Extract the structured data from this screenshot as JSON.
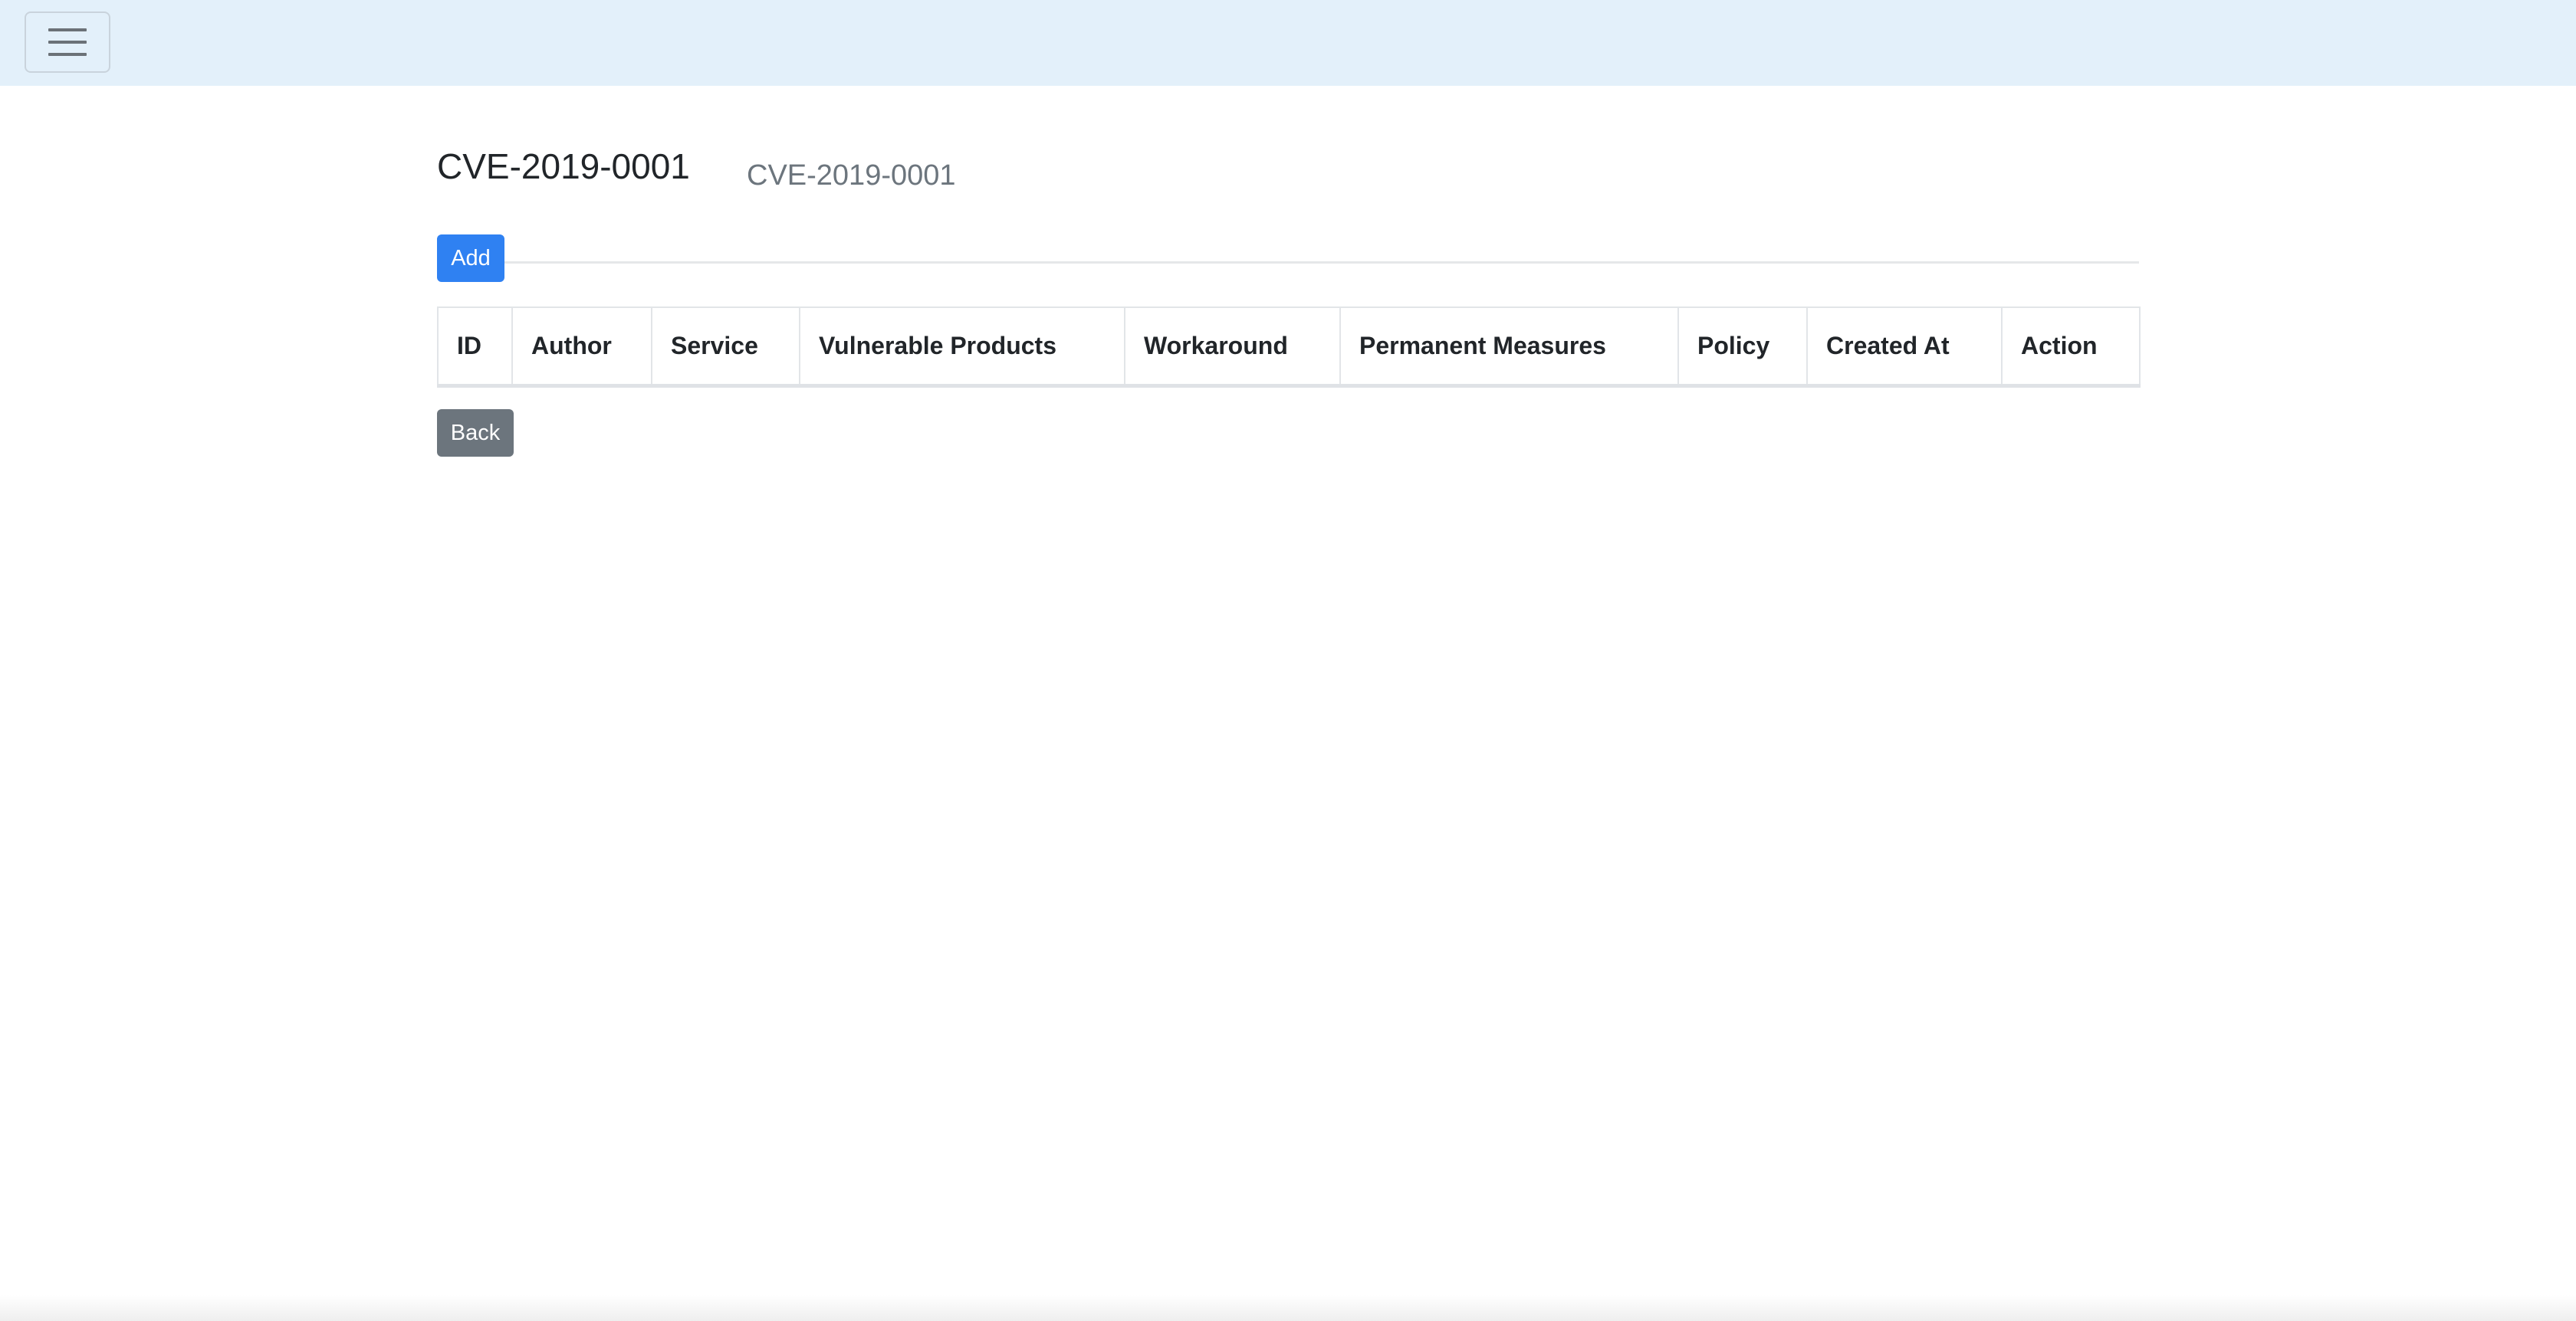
{
  "navbar": {
    "toggler_icon": "hamburger-menu-icon"
  },
  "page": {
    "title": "CVE-2019-0001",
    "subtitle": "CVE-2019-0001"
  },
  "actions": {
    "add_label": "Add",
    "back_label": "Back"
  },
  "table": {
    "columns": [
      "ID",
      "Author",
      "Service",
      "Vulnerable Products",
      "Workaround",
      "Permanent Measures",
      "Policy",
      "Created At",
      "Action"
    ],
    "rows": []
  },
  "colors": {
    "navbar_bg": "#e3f0fa",
    "primary": "#2f81f2",
    "secondary": "#6c757d",
    "muted_text": "#6c757d"
  }
}
